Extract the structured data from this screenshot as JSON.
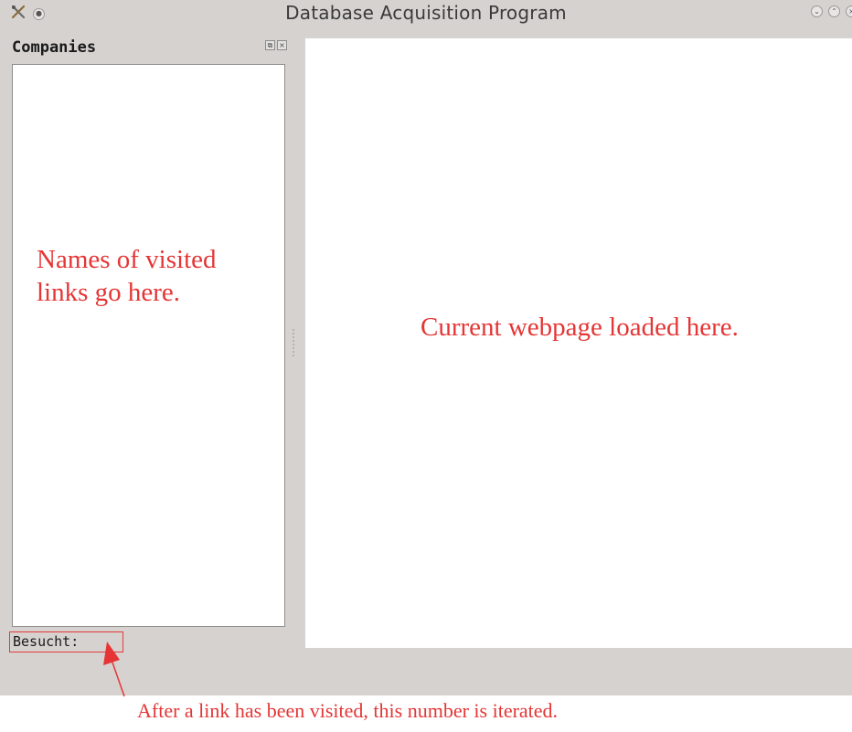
{
  "window": {
    "title": "Database Acquisition Program"
  },
  "dock": {
    "title": "Companies",
    "float_icon": "⧉",
    "close_icon": "×"
  },
  "status": {
    "label": "Besucht:"
  },
  "annotations": {
    "list_note": "Names of visited links go here.",
    "web_note": "Current webpage loaded here.",
    "counter_note": "After a link has been visited, this number is iterated."
  },
  "colors": {
    "annotation": "#e53535",
    "window_bg": "#d6d2d0"
  },
  "icons": [
    "app-tools-icon",
    "window-menu-icon",
    "minimize-icon",
    "maximize-icon",
    "close-icon",
    "arrow-icon"
  ]
}
